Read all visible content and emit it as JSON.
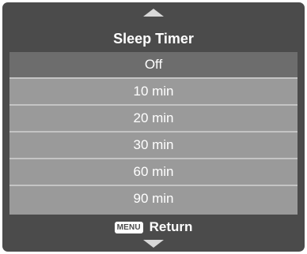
{
  "menu": {
    "title": "Sleep Timer",
    "options": [
      {
        "label": "Off"
      },
      {
        "label": "10 min"
      },
      {
        "label": "20 min"
      },
      {
        "label": "30 min"
      },
      {
        "label": "60 min"
      },
      {
        "label": "90 min"
      }
    ],
    "selected_option": "Off",
    "footer": {
      "key_label": "MENU",
      "action_label": "Return"
    }
  },
  "icons": {
    "scroll_up": "triangle-up-icon",
    "scroll_down": "triangle-down-icon"
  },
  "colors": {
    "panel": "#4b4b4b",
    "list_row": "#9a9a9a",
    "selected_row": "#6d6d6d",
    "text": "#ffffff"
  }
}
